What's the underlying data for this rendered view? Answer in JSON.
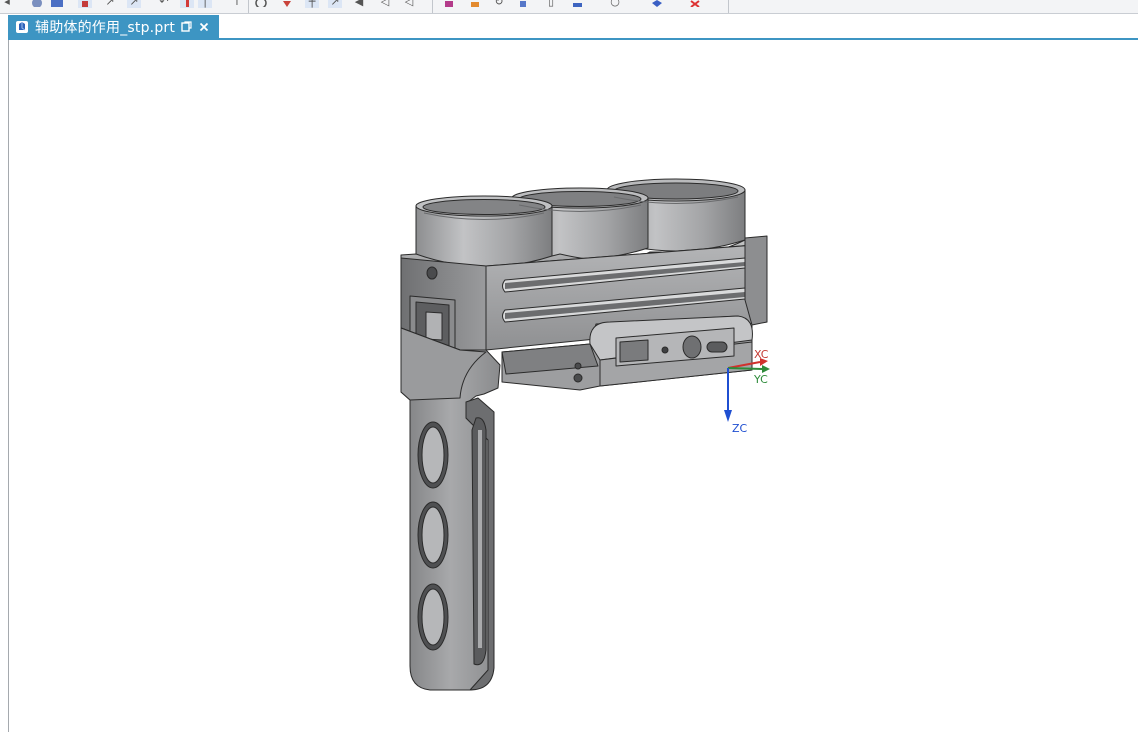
{
  "document_tab": {
    "title": "辅助体的作用_stp.prt",
    "file_icon": "nx-part-file-icon",
    "restore_icon": "restore-window-icon",
    "close_icon": "close-icon"
  },
  "toolbar": {
    "icons": [
      "snap-icon",
      "view-orient-icon",
      "shaded-icon",
      "edit-object-icon",
      "select-icon",
      "curve-icon",
      "rotate-icon",
      "point-icon",
      "line-icon",
      "select-filter-icon",
      "triad-icon",
      "sketch-icon",
      "measure-icon",
      "datum-icon",
      "sheet-icon",
      "undo-icon",
      "render-icon",
      "section-icon",
      "lighting-icon",
      "blend-icon",
      "layer-icon",
      "display-icon",
      "color-icon",
      "cube-icon",
      "delete-icon"
    ]
  },
  "wcs_triad": {
    "x_label": "XC",
    "y_label": "YC",
    "z_label": "ZC",
    "x_color": "#d0312d",
    "y_color": "#2e8b3a",
    "z_color": "#1f4fd1"
  },
  "model": {
    "name": "camera-rig-handle-bracket",
    "shade_color": "#a7a9ab"
  }
}
